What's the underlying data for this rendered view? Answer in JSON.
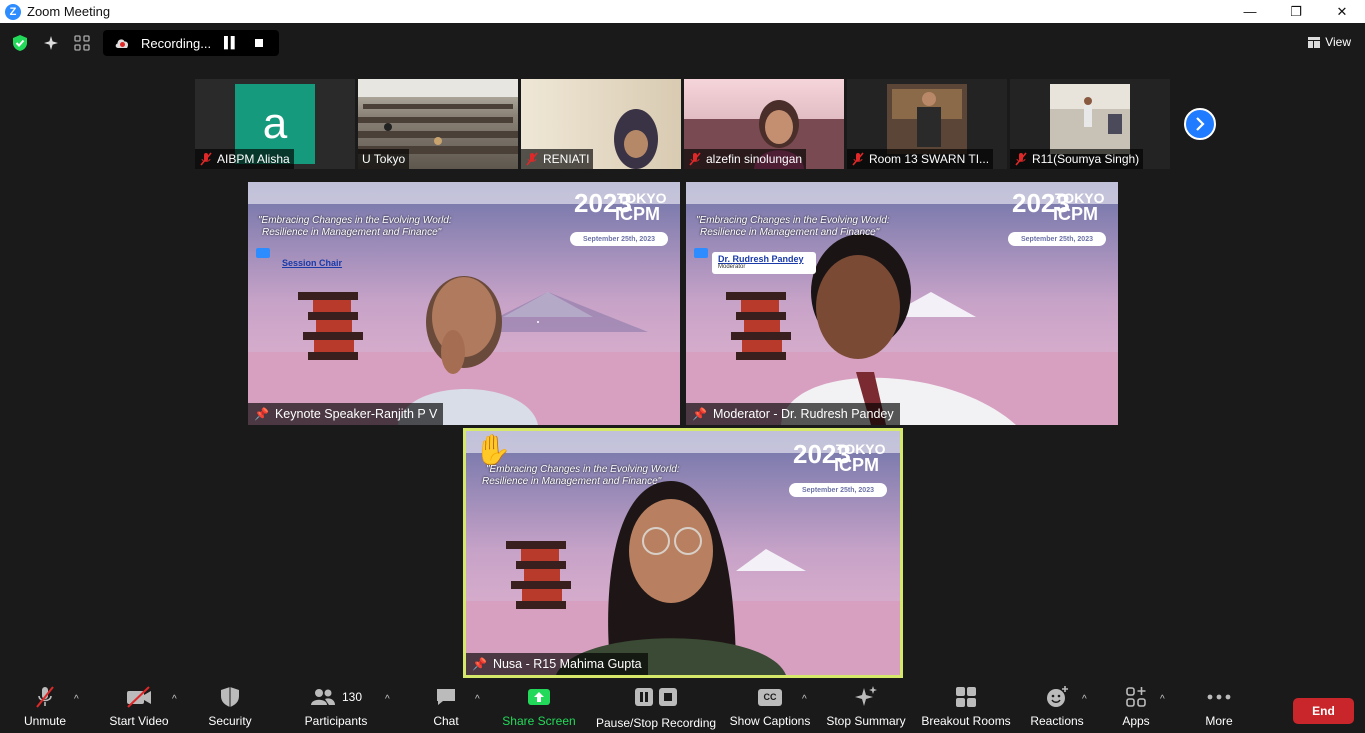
{
  "window": {
    "title": "Zoom Meeting",
    "minimize": "—",
    "maximize": "❐",
    "close": "✕"
  },
  "topbar": {
    "recording_label": "Recording...",
    "view_label": "View"
  },
  "thumbnails": [
    {
      "name": "AIBPM Alisha",
      "initial": "a",
      "muted": true
    },
    {
      "name": "U Tokyo",
      "muted": false
    },
    {
      "name": "RENIATI",
      "muted": true
    },
    {
      "name": "alzefin sinolungan",
      "muted": true
    },
    {
      "name": "Room 13 SWARN TI...",
      "muted": true
    },
    {
      "name": "R11(Soumya Singh)",
      "muted": true
    }
  ],
  "banner": {
    "quote_line1": "\"Embracing Changes in the Evolving World:",
    "quote_line2": "Resilience in Management and Finance\"",
    "year": "2023",
    "city": "TOKYO",
    "conf": "ICPM",
    "date": "September 25th, 2023"
  },
  "tiles": [
    {
      "name": "Keynote Speaker-Ranjith P V",
      "badge": "Session Chair"
    },
    {
      "name": "Moderator - Dr. Rudresh Pandey",
      "badge": "Dr. Rudresh Pandey",
      "badge_sub": "Moderator"
    },
    {
      "name": "Nusa - R15 Mahima Gupta",
      "hand": "✋"
    }
  ],
  "toolbar": {
    "unmute": "Unmute",
    "start_video": "Start Video",
    "security": "Security",
    "participants": "Participants",
    "participants_count": "130",
    "chat": "Chat",
    "share_screen": "Share Screen",
    "pause_stop": "Pause/Stop Recording",
    "show_captions": "Show Captions",
    "cc": "CC",
    "stop_summary": "Stop Summary",
    "breakout": "Breakout Rooms",
    "reactions": "Reactions",
    "apps": "Apps",
    "more": "More",
    "end": "End"
  },
  "colors": {
    "accent": "#2d8cff",
    "share_green": "#23d959",
    "end_red": "#c8262a",
    "speaker_border": "#d5e86a"
  }
}
